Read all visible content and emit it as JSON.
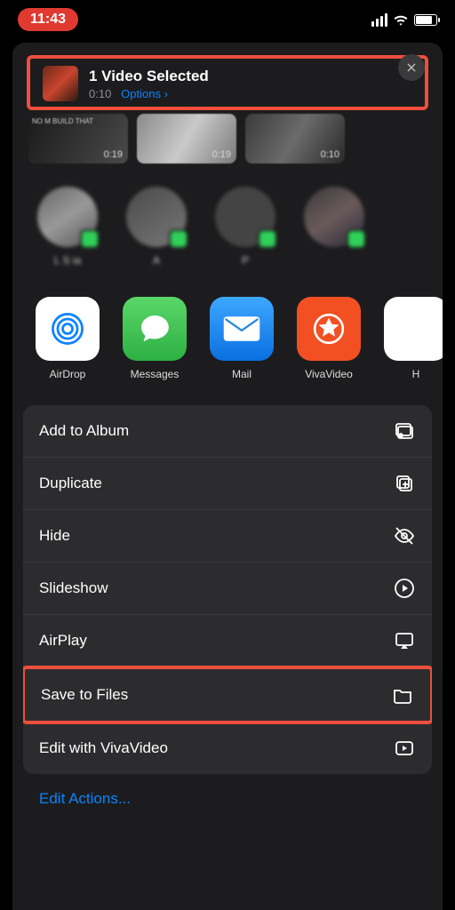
{
  "status": {
    "time": "11:43"
  },
  "header": {
    "title": "1 Video Selected",
    "duration": "0:10",
    "options_label": "Options",
    "chevron": "›"
  },
  "thumbnails": [
    {
      "duration": "0:19",
      "overlay": "NO M\nBUILD THAT"
    },
    {
      "duration": "0:19"
    },
    {
      "duration": "0:10"
    }
  ],
  "contacts": [
    {
      "name": "L\nS      ia"
    },
    {
      "name": "A"
    },
    {
      "name": "P "
    },
    {
      "name": " "
    }
  ],
  "apps": [
    {
      "id": "airdrop",
      "label": "AirDrop"
    },
    {
      "id": "messages",
      "label": "Messages"
    },
    {
      "id": "mail",
      "label": "Mail"
    },
    {
      "id": "vivavideo",
      "label": "VivaVideo"
    },
    {
      "id": "h",
      "label": "H"
    }
  ],
  "actions": [
    {
      "id": "add-album",
      "label": "Add to Album"
    },
    {
      "id": "duplicate",
      "label": "Duplicate"
    },
    {
      "id": "hide",
      "label": "Hide"
    },
    {
      "id": "slideshow",
      "label": "Slideshow"
    },
    {
      "id": "airplay",
      "label": "AirPlay"
    },
    {
      "id": "save-files",
      "label": "Save to Files",
      "highlighted": true
    },
    {
      "id": "edit-viva",
      "label": "Edit with VivaVideo"
    }
  ],
  "footer": {
    "edit_actions": "Edit Actions..."
  }
}
